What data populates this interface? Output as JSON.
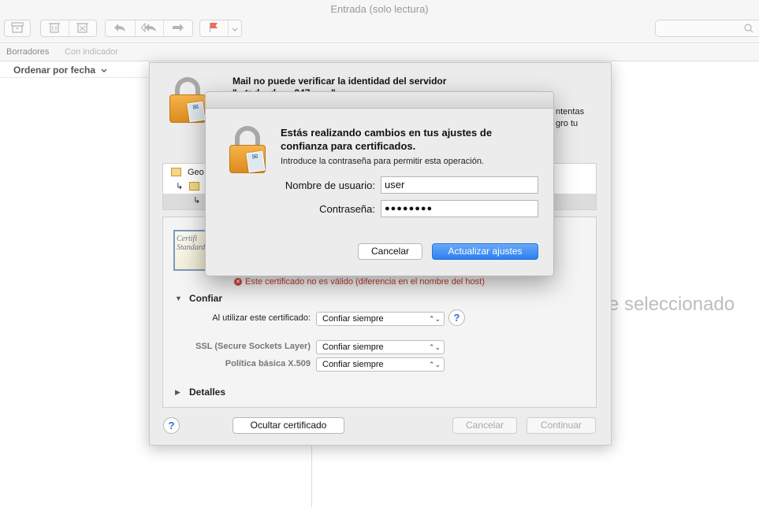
{
  "window": {
    "title": "Entrada (solo lectura)"
  },
  "toolbar": {
    "buttons": [
      "archive-icon",
      "trash-icon",
      "junk-icon",
      "reply-icon",
      "reply-all-icon",
      "forward-icon",
      "flag-icon",
      "chevron-down-icon"
    ]
  },
  "favorites": {
    "items": [
      "Borradores",
      "Con indicador"
    ]
  },
  "list": {
    "sort_label": "Ordenar por fecha",
    "sort_arrow": "⌄"
  },
  "viewer": {
    "empty_text": "e seleccionado"
  },
  "sheet": {
    "title_line1": "Mail no puede verificar la identidad del servidor",
    "title_line2": "\"...tr.d... d... ...247 ... ...\"",
    "side_text": "ntentas\ngro tu",
    "tree": [
      {
        "label": "Geo"
      },
      {
        "label": ""
      },
      {
        "label": ""
      }
    ],
    "invalid_message": "Este certificado no es válido (diferencia en el nombre del host)",
    "trust": {
      "section_label": "Confiar",
      "when_using_label": "Al utilizar este certificado:",
      "when_using_value": "Confiar siempre",
      "ssl_label": "SSL (Secure Sockets Layer)",
      "ssl_value": "Confiar siempre",
      "x509_label": "Política básica X.509",
      "x509_value": "Confiar siempre"
    },
    "details_label": "Detalles",
    "cert_image_text": "Certifi Standard",
    "buttons": {
      "hide_cert": "Ocultar certificado",
      "cancel": "Cancelar",
      "continue": "Continuar",
      "help": "?"
    }
  },
  "auth": {
    "heading": "Estás realizando cambios en tus ajustes de confianza para certificados.",
    "subtitle": "Introduce la contraseña para permitir esta operación.",
    "username_label": "Nombre de usuario:",
    "username_value": "user",
    "password_label": "Contraseña:",
    "password_value": "●●●●●●●●",
    "cancel_label": "Cancelar",
    "update_label": "Actualizar ajustes"
  },
  "colors": {
    "accent": "#2d7ff0",
    "error": "#c0392b",
    "lock_body": "#e89a2c"
  }
}
